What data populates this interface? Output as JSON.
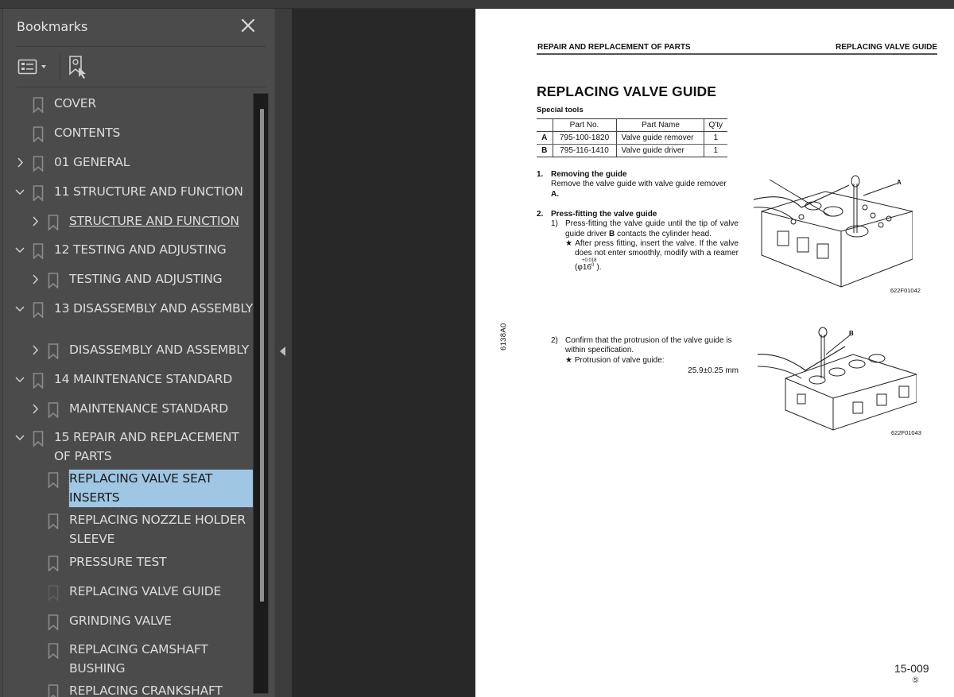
{
  "bookmarks_panel": {
    "title": "Bookmarks",
    "close_icon": "close-icon",
    "toolbar": {
      "options_icon": "list-options-icon",
      "find_icon": "find-current-bookmark-icon"
    },
    "items": [
      {
        "label": "COVER",
        "level": 0,
        "expander": "none"
      },
      {
        "label": "CONTENTS",
        "level": 0,
        "expander": "none"
      },
      {
        "label": "01 GENERAL",
        "level": 0,
        "expander": "collapsed"
      },
      {
        "label": "11 STRUCTURE AND FUNCTION",
        "level": 0,
        "expander": "expanded"
      },
      {
        "label": "STRUCTURE AND FUNCTION",
        "level": 1,
        "expander": "collapsed",
        "hovered": true
      },
      {
        "label": "12 TESTING AND ADJUSTING",
        "level": 0,
        "expander": "expanded"
      },
      {
        "label": "TESTING AND ADJUSTING",
        "level": 1,
        "expander": "collapsed"
      },
      {
        "label": "13 DISASSEMBLY AND ASSEMBLY",
        "level": 0,
        "expander": "expanded"
      },
      {
        "label": "DISASSEMBLY AND ASSEMBLY",
        "level": 1,
        "expander": "collapsed"
      },
      {
        "label": "14 MAINTENANCE STANDARD",
        "level": 0,
        "expander": "expanded"
      },
      {
        "label": "MAINTENANCE STANDARD",
        "level": 1,
        "expander": "collapsed"
      },
      {
        "label": "15 REPAIR AND REPLACEMENT OF PARTS",
        "level": 0,
        "expander": "expanded"
      },
      {
        "label": "REPLACING VALVE SEAT INSERTS",
        "level": 1,
        "expander": "none",
        "selected": true
      },
      {
        "label": "REPLACING NOZZLE HOLDER SLEEVE",
        "level": 1,
        "expander": "none"
      },
      {
        "label": "PRESSURE TEST",
        "level": 1,
        "expander": "none"
      },
      {
        "label": "REPLACING VALVE GUIDE",
        "level": 1,
        "expander": "none",
        "current": true
      },
      {
        "label": "GRINDING VALVE",
        "level": 1,
        "expander": "none"
      },
      {
        "label": "REPLACING CAMSHAFT BUSHING",
        "level": 1,
        "expander": "none"
      },
      {
        "label": "REPLACING CRANKSHAFT",
        "level": 1,
        "expander": "none"
      }
    ]
  },
  "splitter": {
    "icon": "collapse-panel-left-icon"
  },
  "document_page": {
    "header_left": "REPAIR AND REPLACEMENT OF PARTS",
    "header_right": "REPLACING VALVE GUIDE",
    "title": "REPLACING VALVE GUIDE",
    "special_tools_label": "Special tools",
    "tools_table": {
      "columns": [
        "",
        "Part No.",
        "Part Name",
        "Q'ty"
      ],
      "rows": [
        [
          "A",
          "795-100-1820",
          "Valve guide remover",
          "1"
        ],
        [
          "B",
          "795-116-1410",
          "Valve guide driver",
          "1"
        ]
      ]
    },
    "steps": {
      "s1_num": "1.",
      "s1_title": "Removing the guide",
      "s1_text": "Remove the valve guide with valve guide remover",
      "s1_ref": "A.",
      "s2_num": "2.",
      "s2_title": "Press-fitting the valve guide",
      "s2_1_num": "1)",
      "s2_1_text_a": "Press-fitting the valve guide until the tip of valve guide driver",
      "s2_1_ref": "B",
      "s2_1_text_b": "contacts the cylinder head.",
      "s2_1_note": "★ After press fitting, insert the valve.  If the valve does not enter smoothly, modify with a reamer (φ16",
      "s2_1_tol_upper": "+0.018",
      "s2_1_tol_lower": "0",
      "s2_1_note_end": ").",
      "s2_2_num": "2)",
      "s2_2_text": "Confirm that the protrusion of the valve guide is within specification.",
      "s2_2_note": "★ Protrusion of valve guide:",
      "s2_2_value": "25.9±0.25 mm"
    },
    "side_code": "6138A0",
    "figures": [
      {
        "label": "A",
        "caption": "622F01042"
      },
      {
        "label": "B",
        "caption": "622F01043"
      }
    ],
    "page_number": "15-009",
    "revision_mark": "⑤"
  }
}
